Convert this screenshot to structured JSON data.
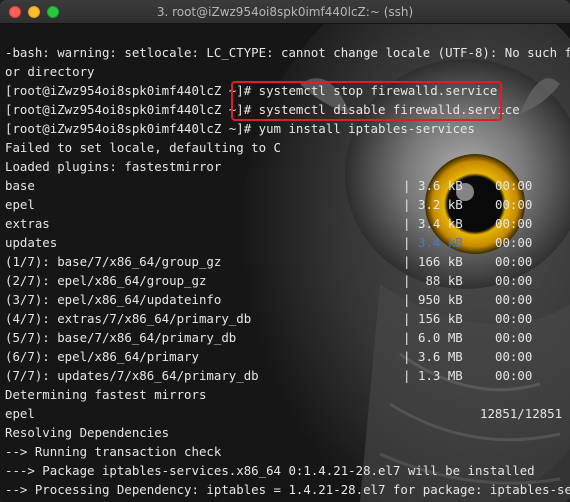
{
  "window": {
    "title": "3. root@iZwz954oi8spk0imf440lcZ:~ (ssh)"
  },
  "terminal": {
    "lines": [
      "-bash: warning: setlocale: LC_CTYPE: cannot change locale (UTF-8): No such file",
      "or directory",
      "[root@iZwz954oi8spk0imf440lcZ ~]# systemctl stop firewalld.service",
      "[root@iZwz954oi8spk0imf440lcZ ~]# systemctl disable firewalld.service",
      "[root@iZwz954oi8spk0imf440lcZ ~]# yum install iptables-services",
      "Failed to set locale, defaulting to C",
      "Loaded plugins: fastestmirror"
    ],
    "repos": [
      {
        "name": "base",
        "size": "3.6 kB",
        "time": "00:00"
      },
      {
        "name": "epel",
        "size": "3.2 kB",
        "time": "00:00"
      },
      {
        "name": "extras",
        "size": "3.4 kB",
        "time": "00:00"
      },
      {
        "name": "updates",
        "size": "3.4 kB",
        "time": "00:00"
      },
      {
        "name": "(1/7): base/7/x86_64/group_gz",
        "size": "166 kB",
        "time": "00:00"
      },
      {
        "name": "(2/7): epel/x86_64/group_gz",
        "size": " 88 kB",
        "time": "00:00"
      },
      {
        "name": "(3/7): epel/x86_64/updateinfo",
        "size": "950 kB",
        "time": "00:00"
      },
      {
        "name": "(4/7): extras/7/x86_64/primary_db",
        "size": "156 kB",
        "time": "00:00"
      },
      {
        "name": "(5/7): base/7/x86_64/primary_db",
        "size": "6.0 MB",
        "time": "00:00"
      },
      {
        "name": "(6/7): epel/x86_64/primary",
        "size": "3.6 MB",
        "time": "00:00"
      },
      {
        "name": "(7/7): updates/7/x86_64/primary_db",
        "size": "1.3 MB",
        "time": "00:00"
      }
    ],
    "tail": [
      "Determining fastest mirrors",
      "epel",
      "Resolving Dependencies",
      "--> Running transaction check",
      "---> Package iptables-services.x86_64 0:1.4.21-28.el7 will be installed",
      "--> Processing Dependency: iptables = 1.4.21-28.el7 for package: iptables-servic"
    ],
    "epel_count": "12851/12851",
    "bar_separator": "|"
  },
  "colors": {
    "highlight": "#e21c26",
    "background": "#161616",
    "text": "#e6e6e6"
  }
}
